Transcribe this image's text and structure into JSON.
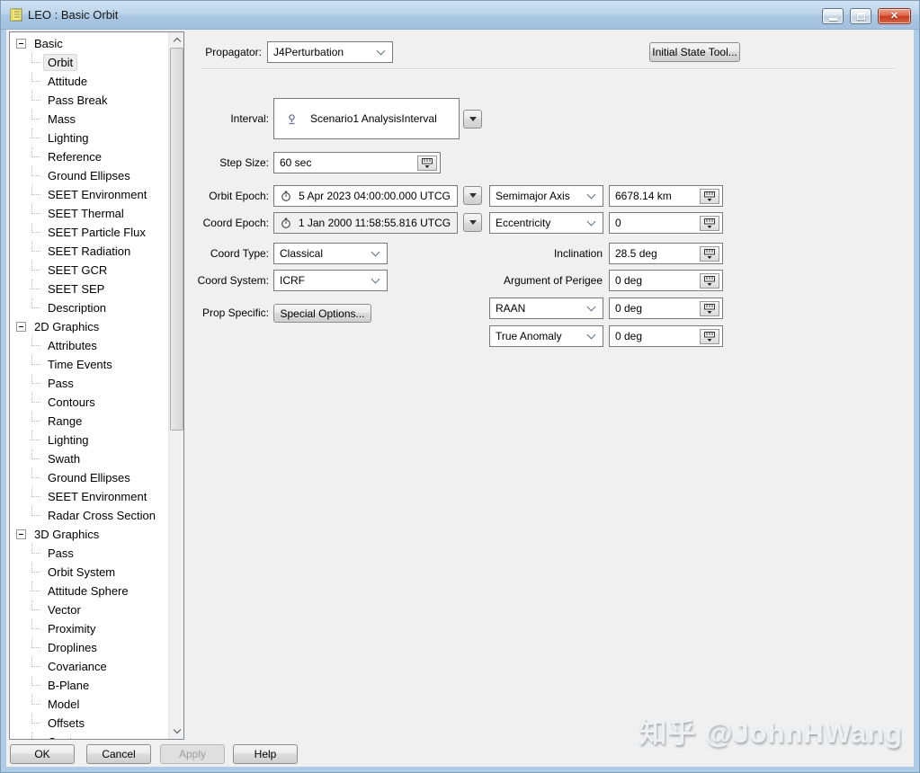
{
  "window": {
    "title": "LEO : Basic Orbit",
    "controls": {
      "minimize": "minimize",
      "maximize": "maximize",
      "close": "close"
    }
  },
  "tree": {
    "items": [
      {
        "label": "Basic",
        "level": 0,
        "expanded": true
      },
      {
        "label": "Orbit",
        "level": 1,
        "selected": true
      },
      {
        "label": "Attitude",
        "level": 1
      },
      {
        "label": "Pass Break",
        "level": 1
      },
      {
        "label": "Mass",
        "level": 1
      },
      {
        "label": "Lighting",
        "level": 1
      },
      {
        "label": "Reference",
        "level": 1
      },
      {
        "label": "Ground Ellipses",
        "level": 1
      },
      {
        "label": "SEET Environment",
        "level": 1
      },
      {
        "label": "SEET Thermal",
        "level": 1
      },
      {
        "label": "SEET Particle Flux",
        "level": 1
      },
      {
        "label": "SEET Radiation",
        "level": 1
      },
      {
        "label": "SEET GCR",
        "level": 1
      },
      {
        "label": "SEET SEP",
        "level": 1
      },
      {
        "label": "Description",
        "level": 1
      },
      {
        "label": "2D Graphics",
        "level": 0,
        "expanded": true
      },
      {
        "label": "Attributes",
        "level": 1
      },
      {
        "label": "Time Events",
        "level": 1
      },
      {
        "label": "Pass",
        "level": 1
      },
      {
        "label": "Contours",
        "level": 1
      },
      {
        "label": "Range",
        "level": 1
      },
      {
        "label": "Lighting",
        "level": 1
      },
      {
        "label": "Swath",
        "level": 1
      },
      {
        "label": "Ground Ellipses",
        "level": 1
      },
      {
        "label": "SEET Environment",
        "level": 1
      },
      {
        "label": "Radar Cross Section",
        "level": 1
      },
      {
        "label": "3D Graphics",
        "level": 0,
        "expanded": true
      },
      {
        "label": "Pass",
        "level": 1
      },
      {
        "label": "Orbit System",
        "level": 1
      },
      {
        "label": "Attitude Sphere",
        "level": 1
      },
      {
        "label": "Vector",
        "level": 1
      },
      {
        "label": "Proximity",
        "level": 1
      },
      {
        "label": "Droplines",
        "level": 1
      },
      {
        "label": "Covariance",
        "level": 1
      },
      {
        "label": "B-Plane",
        "level": 1
      },
      {
        "label": "Model",
        "level": 1
      },
      {
        "label": "Offsets",
        "level": 1
      },
      {
        "label": "Contours",
        "level": 1
      }
    ]
  },
  "form": {
    "propagator": {
      "label": "Propagator:",
      "value": "J4Perturbation"
    },
    "initial_state_tool_label": "Initial State Tool...",
    "interval": {
      "label": "Interval:",
      "value": "Scenario1 AnalysisInterval"
    },
    "step_size": {
      "label": "Step Size:",
      "value": "60 sec"
    },
    "orbit_epoch": {
      "label": "Orbit Epoch:",
      "value": "5 Apr 2023 04:00:00.000 UTCG"
    },
    "coord_epoch": {
      "label": "Coord Epoch:",
      "value": "1 Jan 2000 11:58:55.816 UTCG",
      "readonly": true
    },
    "coord_type": {
      "label": "Coord Type:",
      "value": "Classical"
    },
    "coord_system": {
      "label": "Coord System:",
      "value": "ICRF"
    },
    "prop_specific": {
      "label": "Prop Specific:",
      "button_label": "Special Options..."
    },
    "orbital_elements": [
      {
        "selector": "Semimajor Axis",
        "control": "dropdown",
        "value": "6678.14 km"
      },
      {
        "selector": "Eccentricity",
        "control": "dropdown",
        "value": "0"
      },
      {
        "selector": "Inclination",
        "control": "label",
        "value": "28.5 deg"
      },
      {
        "selector": "Argument of Perigee",
        "control": "label",
        "value": "0 deg"
      },
      {
        "selector": "RAAN",
        "control": "dropdown",
        "value": "0 deg"
      },
      {
        "selector": "True Anomaly",
        "control": "dropdown",
        "value": "0 deg"
      }
    ]
  },
  "footer": {
    "buttons": [
      {
        "label": "OK",
        "disabled": false
      },
      {
        "label": "Cancel",
        "disabled": false
      },
      {
        "label": "Apply",
        "disabled": true
      },
      {
        "label": "Help",
        "disabled": false
      }
    ]
  },
  "watermark": "知乎 @JohnHWang",
  "icons": {
    "app": "notepad-icon",
    "interval": "scenario-time-icon",
    "epoch": "stopwatch-icon",
    "unit": "unit-chooser-icon",
    "combo": "chevron-down-icon",
    "drop": "triangle-down-icon"
  },
  "colors": {
    "titlebar": "#bcd4ea",
    "frame": "#b0cbe5",
    "dialog_bg": "#f0f0f0",
    "field_border": "#7a7a7a",
    "close_button": "#c93c20",
    "tree_bg": "#ffffff"
  }
}
